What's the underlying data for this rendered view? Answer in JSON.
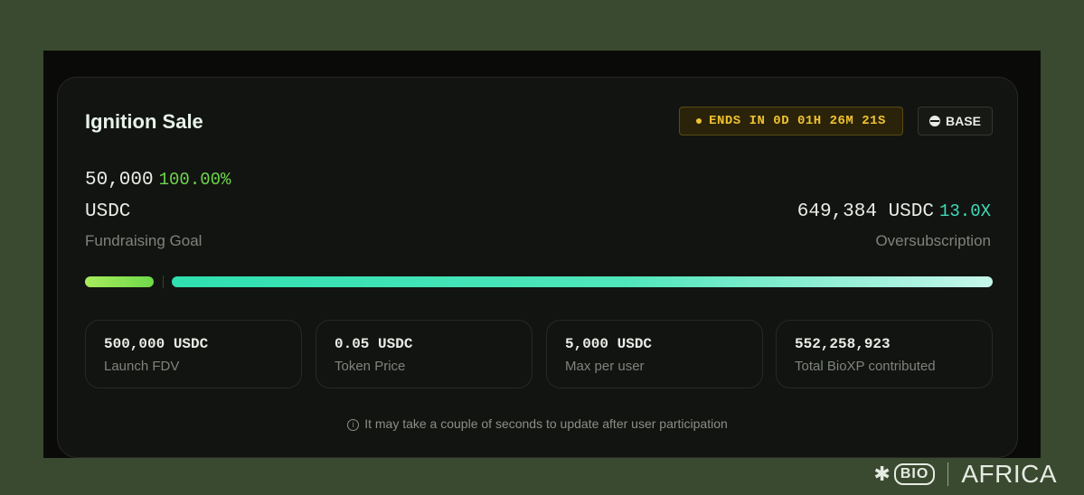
{
  "sale": {
    "title": "Ignition Sale",
    "ends_label": "ENDS IN 0D 01H 26M 21S",
    "network_label": "BASE",
    "goal_amount": "50,000",
    "goal_percent": "100.00%",
    "goal_unit": "USDC",
    "goal_label": "Fundraising Goal",
    "raised_amount": "649,384 USDC",
    "oversubscription_multiple": "13.0X",
    "oversubscription_label": "Oversubscription",
    "progress": {
      "goal_fraction": 1.0,
      "oversubscription_multiple": 13.0
    },
    "stats": [
      {
        "value": "500,000 USDC",
        "label": "Launch FDV"
      },
      {
        "value": "0.05 USDC",
        "label": "Token Price"
      },
      {
        "value": "5,000 USDC",
        "label": "Max per user"
      },
      {
        "value": "552,258,923",
        "label": "Total BioXP contributed"
      }
    ],
    "note": "It may take a couple of seconds to update after user participation"
  },
  "brand": {
    "logo_text": "BIO",
    "region": "AFRICA"
  },
  "colors": {
    "background": "#3a4a30",
    "card": "#121411",
    "goal_accent": "#6ed64c",
    "oversub_accent": "#3fd9b8",
    "timer": "#f0c232"
  },
  "icons": {
    "timer": "dot-icon",
    "network": "base-icon",
    "note": "info-icon"
  }
}
